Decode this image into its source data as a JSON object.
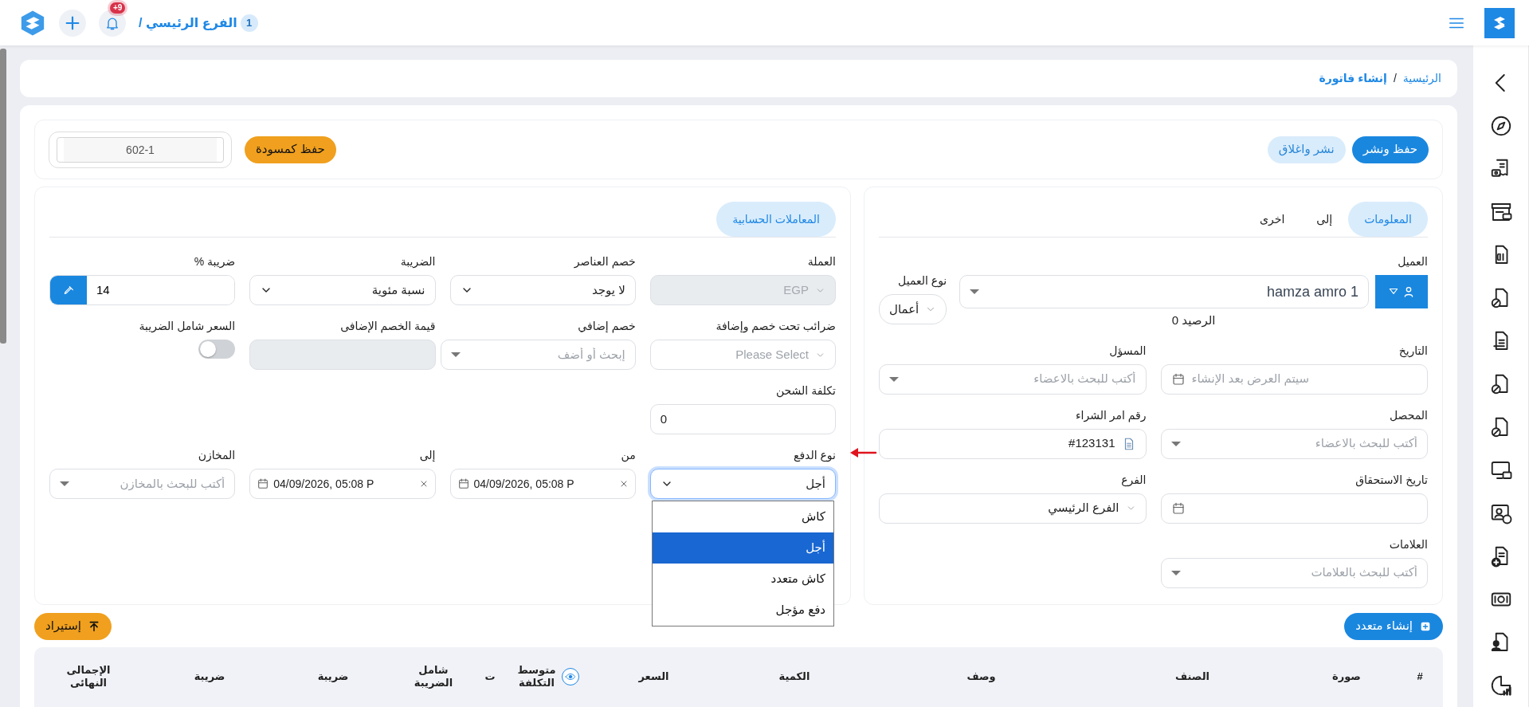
{
  "topbar": {
    "branch_number": "1",
    "branch": "الفرع الرئيسي /",
    "notification_count": "+9"
  },
  "breadcrumb": {
    "items": [
      {
        "label": "الرئيسية",
        "current": false
      },
      {
        "label": "إنشاء فاتورة",
        "current": true
      }
    ],
    "separator": "/"
  },
  "actions": {
    "buttons": [
      {
        "label": "حفظ ونشر",
        "kind": "primary"
      },
      {
        "label": "نشر واغلاق",
        "kind": "soft"
      }
    ],
    "draft_button": "حفظ كمسودة",
    "invoice_number": "602-1"
  },
  "info_panel": {
    "tabs": [
      {
        "label": "المعلومات",
        "selected": true
      },
      {
        "label": "إلى",
        "selected": false
      },
      {
        "label": "اخرى",
        "selected": false
      }
    ],
    "customer": {
      "label": "العميل",
      "value": "hamza amro 1"
    },
    "customer_type": {
      "label": "نوع العميل",
      "value": "أعمال"
    },
    "balance": "الرصيد 0",
    "rows": [
      [
        {
          "label": "التاريخ",
          "kind": "date",
          "placeholder": "سيتم العرض بعد الإنشاء",
          "disabled": false
        },
        {
          "label": "المسؤل",
          "kind": "search",
          "placeholder": "أكتب للبحث بالاعضاء",
          "disabled": false
        }
      ],
      [
        {
          "label": "المحصل",
          "kind": "search",
          "placeholder": "أكتب للبحث بالاعضاء",
          "disabled": false
        },
        {
          "label": "رقم امر الشراء",
          "kind": "doc",
          "value": "#123131",
          "disabled": false
        }
      ],
      [
        {
          "label": "تاريخ الاستحقاق",
          "kind": "date",
          "disabled": false
        },
        {
          "label": "الفرع",
          "kind": "combo",
          "value": "الفرع الرئيسي",
          "disabled": false
        }
      ],
      [
        {
          "label": "العلامات",
          "kind": "search",
          "placeholder": "أكتب للبحث بالعلامات",
          "disabled": false
        }
      ]
    ]
  },
  "accounting_panel": {
    "tabs": [
      {
        "label": "المعاملات الحسابية",
        "selected": true
      }
    ],
    "rows": [
      [
        {
          "label": "العملة",
          "kind": "combo",
          "value": "EGP",
          "disabled": true
        },
        {
          "label": "خصم العناصر",
          "kind": "select",
          "value": "لا يوجد",
          "disabled": false
        },
        {
          "label": "الضريبة",
          "kind": "select",
          "value": "نسبة مئوية",
          "disabled": false
        },
        {
          "label": "ضريبة %",
          "kind": "picker",
          "value": "14",
          "disabled": false
        }
      ],
      [
        {
          "label": "ضرائب تحت خصم وإضافة",
          "kind": "combo",
          "placeholder": "Please Select",
          "disabled": false
        },
        {
          "label": "خصم إضافي",
          "kind": "search_add",
          "placeholder": "إبحث أو أضف",
          "disabled": false
        },
        {
          "label": "قيمة الخصم الإضافى",
          "kind": "text",
          "disabled": true
        },
        {
          "label": "السعر شامل الضريبة",
          "kind": "toggle",
          "on": false,
          "disabled": false
        }
      ],
      [
        {
          "label": "تكلفة الشحن",
          "kind": "text",
          "value": "0",
          "disabled": false
        }
      ],
      [
        {
          "label": "نوع الدفع",
          "kind": "select",
          "value": "أجل",
          "disabled": false,
          "open": true,
          "options": [
            {
              "label": "كاش",
              "selected": false
            },
            {
              "label": "أجل",
              "selected": true
            },
            {
              "label": "كاش متعدد",
              "selected": false
            },
            {
              "label": "دفع مؤجل",
              "selected": false
            }
          ]
        },
        {
          "label": "من",
          "kind": "datetime",
          "value": "04/09/2026, 05:08 P",
          "disabled": false
        },
        {
          "label": "إلى",
          "kind": "datetime",
          "value": "04/09/2026, 05:08 P",
          "disabled": false
        },
        {
          "label": "المخازن",
          "kind": "search",
          "placeholder": "أكتب للبحث بالمخازن",
          "disabled": false
        }
      ]
    ]
  },
  "multi_create_button": "إنشاء متعدد",
  "import_button": "إستيراد",
  "table": {
    "columns": [
      {
        "label": "#",
        "kind": "text"
      },
      {
        "label": "صورة",
        "kind": "text"
      },
      {
        "label": "الصنف",
        "kind": "text"
      },
      {
        "label": "وصف",
        "kind": "text"
      },
      {
        "label": "الكمية",
        "kind": "text"
      },
      {
        "label": "السعر",
        "kind": "text"
      },
      {
        "label": "متوسط التكلفة",
        "kind": "toggle"
      },
      {
        "label": "ت",
        "kind": "text"
      },
      {
        "label": "شامل الضريبة",
        "kind": "text"
      },
      {
        "label": "ضريبة",
        "kind": "text"
      },
      {
        "label": "ضريبة",
        "kind": "text"
      },
      {
        "label": "الإجمالى النهائى",
        "kind": "text"
      }
    ]
  }
}
